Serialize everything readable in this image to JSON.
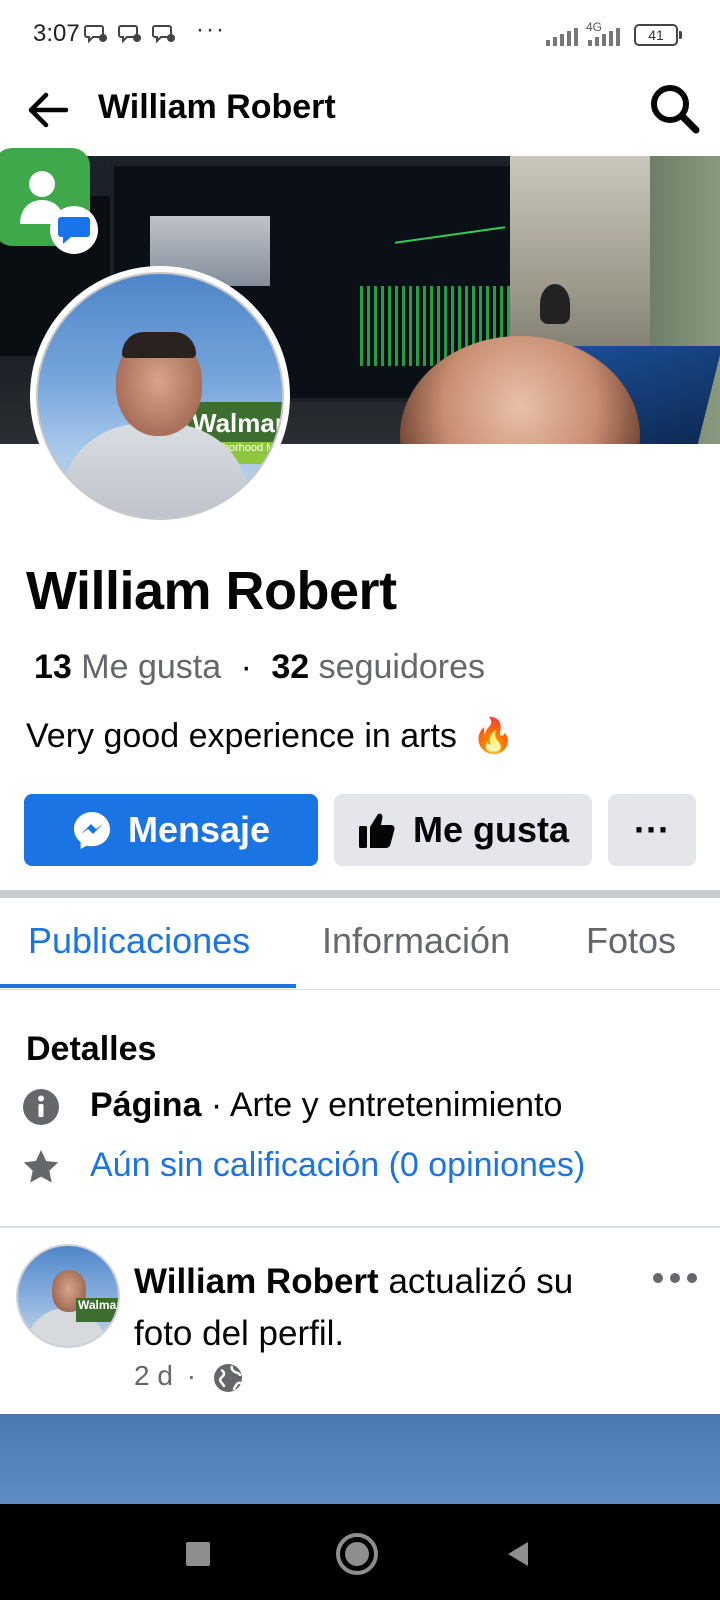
{
  "status_bar": {
    "time": "3:07",
    "more": "···",
    "network": "4G",
    "battery": "41"
  },
  "header": {
    "title": "William Robert",
    "back_icon": "arrow-left-icon",
    "search_icon": "search-icon"
  },
  "profile": {
    "name": "William Robert",
    "likes_count": "13",
    "likes_label": "Me gusta",
    "separator": "·",
    "followers_count": "32",
    "followers_label": "seguidores",
    "bio": "Very good experience in arts",
    "bio_emoji": "🔥",
    "profile_sign": "Walmart",
    "profile_sign_sub": "Neighborhood Market"
  },
  "actions": {
    "message_label": "Mensaje",
    "like_label": "Me gusta",
    "more_label": "···"
  },
  "tabs": [
    {
      "label": "Publicaciones",
      "active": true
    },
    {
      "label": "Información",
      "active": false
    },
    {
      "label": "Fotos",
      "active": false
    }
  ],
  "details": {
    "title": "Detalles",
    "category_prefix": "Página",
    "category_suffix": " · Arte y entretenimiento",
    "rating": "Aún sin calificación (0 opiniones)"
  },
  "post": {
    "author": "William Robert",
    "action": " actualizó su foto del perfil.",
    "time": "2 d",
    "separator": "·",
    "more_label": "···",
    "avatar_sign": "Walmart"
  },
  "colors": {
    "accent": "#1b74e4",
    "secondary_text": "#65676b",
    "button_gray": "#e4e6eb",
    "contacts_green": "#3ea84a"
  }
}
